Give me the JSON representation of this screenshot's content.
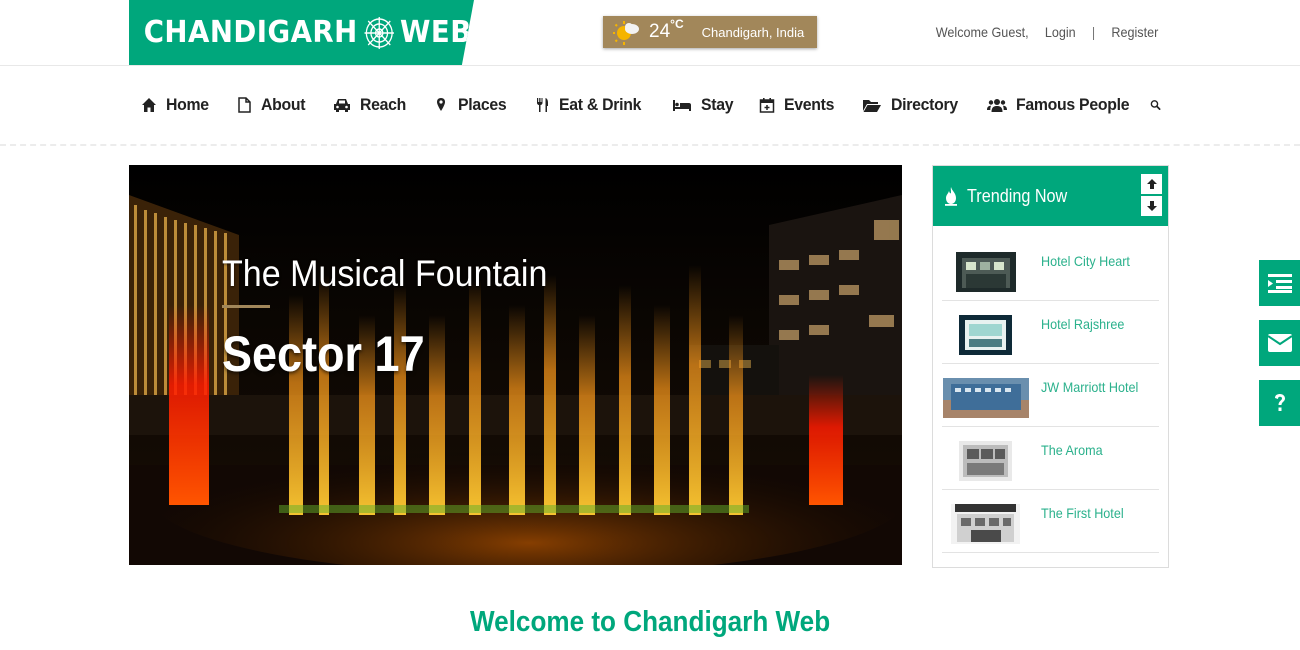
{
  "logo": {
    "part1": "CHANDIGARH",
    "part2": "WEB",
    "icon": "spider-web-icon"
  },
  "weather": {
    "temp": "24",
    "unit": "°C",
    "location": "Chandigarh, India",
    "icon": "sun-cloud-icon"
  },
  "user": {
    "welcome": "Welcome Guest,",
    "login": "Login",
    "separator": "|",
    "register": "Register"
  },
  "nav": {
    "items": [
      {
        "label": "Home",
        "icon": "home-icon"
      },
      {
        "label": "About",
        "icon": "document-icon"
      },
      {
        "label": "Reach",
        "icon": "car-icon"
      },
      {
        "label": "Places",
        "icon": "map-pin-icon"
      },
      {
        "label": "Eat & Drink",
        "icon": "utensils-icon"
      },
      {
        "label": "Stay",
        "icon": "bed-icon"
      },
      {
        "label": "Events",
        "icon": "calendar-icon"
      },
      {
        "label": "Directory",
        "icon": "folder-open-icon"
      },
      {
        "label": "Famous People",
        "icon": "users-icon"
      }
    ],
    "search_icon": "search-icon"
  },
  "hero": {
    "subtitle": "The Musical Fountain",
    "title": "Sector 17"
  },
  "trending": {
    "title": "Trending Now",
    "items": [
      {
        "name": "Hotel City Heart"
      },
      {
        "name": "Hotel Rajshree"
      },
      {
        "name": "JW Marriott Hotel"
      },
      {
        "name": "The Aroma"
      },
      {
        "name": "The First Hotel"
      }
    ]
  },
  "side_buttons": [
    "list-icon",
    "envelope-icon",
    "question-icon"
  ],
  "welcome": "Welcome to Chandigarh Web",
  "colors": {
    "brand": "#00a77c",
    "weather_bg": "#a2875a",
    "link": "#2bb18c"
  }
}
